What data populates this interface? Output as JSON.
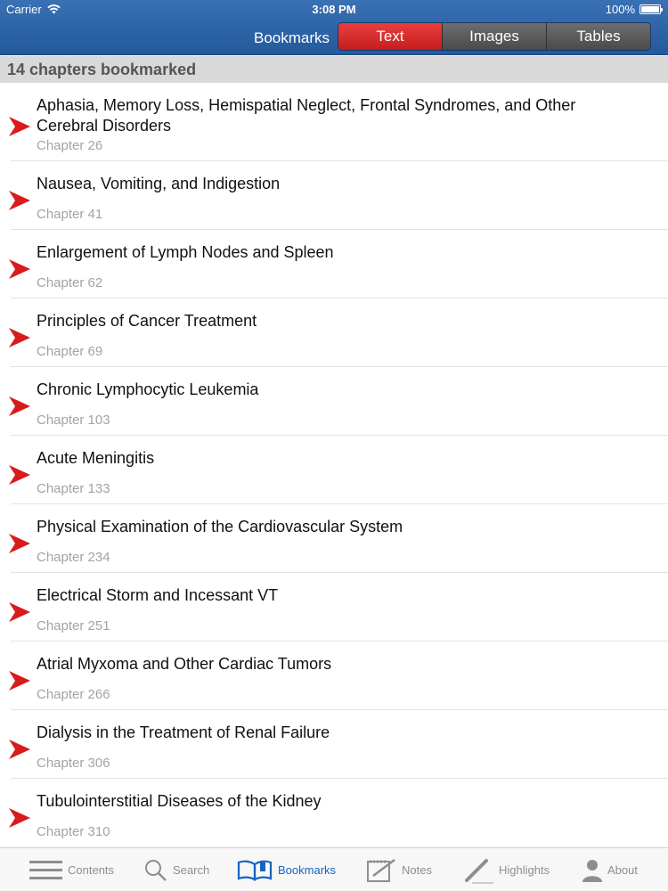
{
  "status_bar": {
    "carrier": "Carrier",
    "time": "3:08 PM",
    "battery": "100%"
  },
  "nav": {
    "title": "Bookmarks",
    "segments": [
      {
        "label": "Text",
        "active": true
      },
      {
        "label": "Images",
        "active": false
      },
      {
        "label": "Tables",
        "active": false
      }
    ]
  },
  "section_header": "14 chapters bookmarked",
  "bookmarks": [
    {
      "title": "Aphasia, Memory Loss, Hemispatial Neglect, Frontal Syndromes, and Other Cerebral Disorders",
      "chapter": "Chapter 26"
    },
    {
      "title": "Nausea, Vomiting, and Indigestion",
      "chapter": "Chapter 41"
    },
    {
      "title": "Enlargement of Lymph Nodes and Spleen",
      "chapter": "Chapter 62"
    },
    {
      "title": "Principles of Cancer Treatment",
      "chapter": "Chapter 69"
    },
    {
      "title": "Chronic Lymphocytic Leukemia",
      "chapter": "Chapter 103"
    },
    {
      "title": "Acute Meningitis",
      "chapter": "Chapter 133"
    },
    {
      "title": "Physical Examination of the Cardiovascular System",
      "chapter": "Chapter 234"
    },
    {
      "title": "Electrical Storm and Incessant VT",
      "chapter": "Chapter 251"
    },
    {
      "title": "Atrial Myxoma and Other Cardiac Tumors",
      "chapter": "Chapter 266"
    },
    {
      "title": "Dialysis in the Treatment of Renal Failure",
      "chapter": "Chapter 306"
    },
    {
      "title": "Tubulointerstitial Diseases of the Kidney",
      "chapter": "Chapter 310"
    }
  ],
  "tabbar": {
    "contents": "Contents",
    "search": "Search",
    "bookmarks": "Bookmarks",
    "notes": "Notes",
    "highlights": "Highlights",
    "about": "About"
  },
  "colors": {
    "header_blue": "#2c64a8",
    "active_segment_red": "#d82a2a",
    "bookmark_arrow_red": "#d81b1b",
    "active_tab_blue": "#1565c0"
  }
}
